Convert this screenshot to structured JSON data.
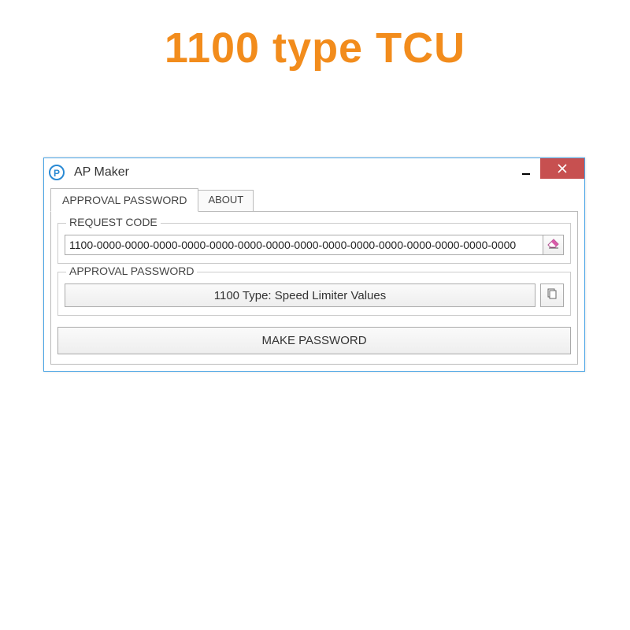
{
  "page_heading": "1100 type TCU",
  "window": {
    "title": "AP Maker",
    "tabs": [
      {
        "label": "APPROVAL PASSWORD",
        "active": true
      },
      {
        "label": "ABOUT",
        "active": false
      }
    ],
    "request_group": {
      "label": "REQUEST CODE",
      "value": "1100-0000-0000-0000-0000-0000-0000-0000-0000-0000-0000-0000-0000-0000-0000-0000"
    },
    "approval_group": {
      "label": "APPROVAL PASSWORD",
      "value": "1100 Type: Speed Limiter Values"
    },
    "make_button": "MAKE PASSWORD"
  }
}
